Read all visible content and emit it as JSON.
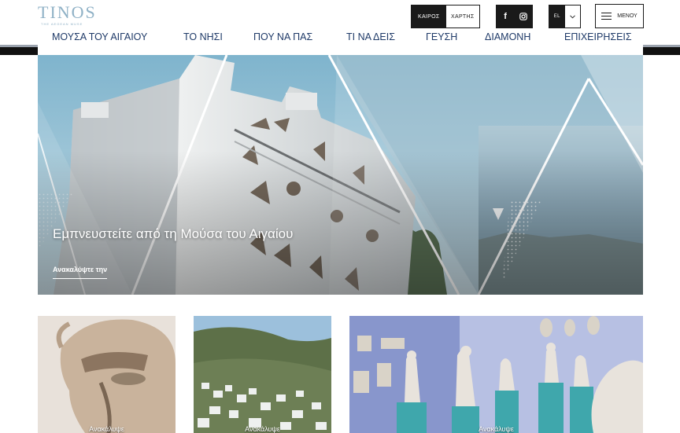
{
  "logo": {
    "name": "TINOS",
    "tagline": "THE AEGEAN MUSE"
  },
  "header": {
    "weather_label": "ΚΑΙΡΟΣ",
    "map_label": "ΧΑΡΤΗΣ",
    "lang_label": "EL",
    "menu_label": "ΜΕΝΟΥ"
  },
  "nav": {
    "items": [
      {
        "label": "ΜΟΥΣΑ ΤΟΥ ΑΙΓΑΙΟΥ"
      },
      {
        "label": "ΤΟ ΝΗΣΙ"
      },
      {
        "label": "ΠΟΥ ΝΑ ΠΑΣ"
      },
      {
        "label": "ΤΙ ΝΑ ΔΕΙΣ"
      },
      {
        "label": "ΓΕΥΣΗ"
      },
      {
        "label": "ΔΙΑΜΟΝΗ"
      },
      {
        "label": "ΕΠΙΧΕΙΡΗΣΕΙΣ"
      }
    ]
  },
  "hero": {
    "title": "Εμπνευστείτε από τη Μούσα του Αιγαίου",
    "link": "Ανακαλύψτε την"
  },
  "cards": [
    {
      "label": "Ανακάλυψε"
    },
    {
      "label": "Ανακάλυψε"
    },
    {
      "label": "Ανακάλυψε"
    }
  ],
  "icons": {
    "facebook": "facebook-icon",
    "instagram": "instagram-icon",
    "lang_toggle": "chevron-down-icon",
    "menu": "hamburger-icon"
  },
  "colors": {
    "brand": "#1f3a68",
    "logo": "#8fb1c6",
    "dark": "#1a1a1a"
  }
}
